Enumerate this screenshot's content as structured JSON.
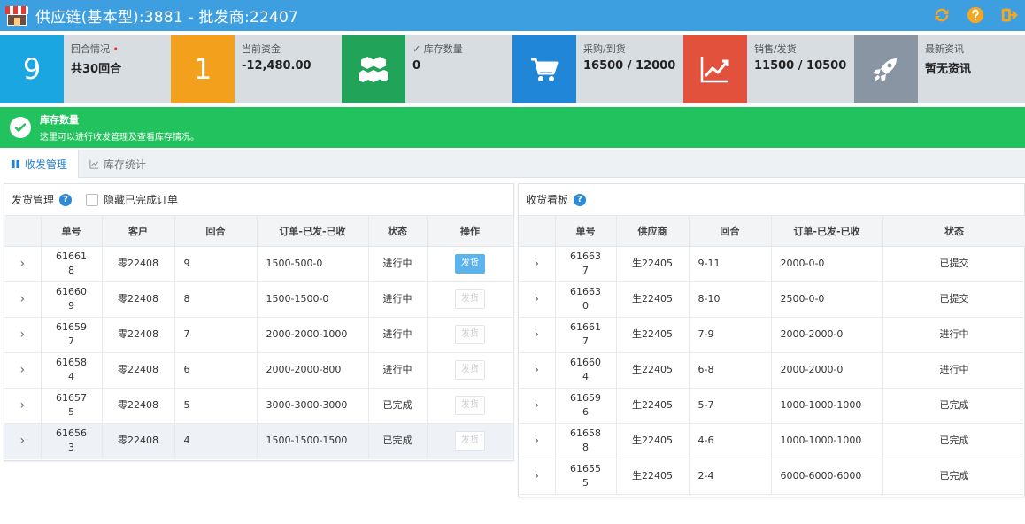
{
  "header": {
    "title": "供应链(基本型):3881 - 批发商:22407",
    "icons": [
      "refresh-icon",
      "help-icon",
      "logout-icon"
    ],
    "accent": "#3d9ee0"
  },
  "stats": [
    {
      "box": "9",
      "label": "回合情况",
      "value": "共30回合",
      "color": "#1aa7e1",
      "marker": "•"
    },
    {
      "box": "1",
      "label": "当前资金",
      "value": "-12,480.00",
      "color": "#f3a11c"
    },
    {
      "icon": "cubes-icon",
      "label": "✓ 库存数量",
      "value": "0",
      "color": "#22a35a"
    },
    {
      "icon": "cart-icon",
      "label": "采购/到货",
      "value": "16500 / 12000",
      "color": "#1f86d8"
    },
    {
      "icon": "chart-icon",
      "label": "销售/发货",
      "value": "11500 / 10500",
      "color": "#e2513c"
    },
    {
      "icon": "rocket-icon",
      "label": "最新资讯",
      "value": "暂无资讯",
      "color": "#8995a3"
    }
  ],
  "alert": {
    "title": "库存数量",
    "text": "这里可以进行收发管理及查看库存情况。",
    "color": "#22c35e"
  },
  "tabs": [
    {
      "label": "收发管理",
      "active": true
    },
    {
      "label": "库存统计",
      "active": false
    }
  ],
  "shipping": {
    "title": "发货管理",
    "hide_label": "隐藏已完成订单",
    "columns": [
      "单号",
      "客户",
      "回合",
      "订单-已发-已收",
      "状态",
      "操作"
    ],
    "action_label": "发货",
    "rows": [
      {
        "id": "616618",
        "customer": "零22408",
        "round": "9",
        "order": "1500-500-0",
        "status": "进行中",
        "enabled": true
      },
      {
        "id": "616609",
        "customer": "零22408",
        "round": "8",
        "order": "1500-1500-0",
        "status": "进行中",
        "enabled": false
      },
      {
        "id": "616597",
        "customer": "零22408",
        "round": "7",
        "order": "2000-2000-1000",
        "status": "进行中",
        "enabled": false
      },
      {
        "id": "616584",
        "customer": "零22408",
        "round": "6",
        "order": "2000-2000-800",
        "status": "进行中",
        "enabled": false
      },
      {
        "id": "616575",
        "customer": "零22408",
        "round": "5",
        "order": "3000-3000-3000",
        "status": "已完成",
        "enabled": false
      },
      {
        "id": "616563",
        "customer": "零22408",
        "round": "4",
        "order": "1500-1500-1500",
        "status": "已完成",
        "enabled": false
      }
    ]
  },
  "receiving": {
    "title": "收货看板",
    "columns": [
      "单号",
      "供应商",
      "回合",
      "订单-已发-已收",
      "状态"
    ],
    "rows": [
      {
        "id": "616637",
        "supplier": "生22405",
        "round": "9-11",
        "order": "2000-0-0",
        "status": "已提交"
      },
      {
        "id": "616630",
        "supplier": "生22405",
        "round": "8-10",
        "order": "2500-0-0",
        "status": "已提交"
      },
      {
        "id": "616617",
        "supplier": "生22405",
        "round": "7-9",
        "order": "2000-2000-0",
        "status": "进行中"
      },
      {
        "id": "616604",
        "supplier": "生22405",
        "round": "6-8",
        "order": "2000-2000-0",
        "status": "进行中"
      },
      {
        "id": "616596",
        "supplier": "生22405",
        "round": "5-7",
        "order": "1000-1000-1000",
        "status": "已完成"
      },
      {
        "id": "616588",
        "supplier": "生22405",
        "round": "4-6",
        "order": "1000-1000-1000",
        "status": "已完成"
      },
      {
        "id": "616555",
        "supplier": "生22405",
        "round": "2-4",
        "order": "6000-6000-6000",
        "status": "已完成"
      }
    ]
  }
}
